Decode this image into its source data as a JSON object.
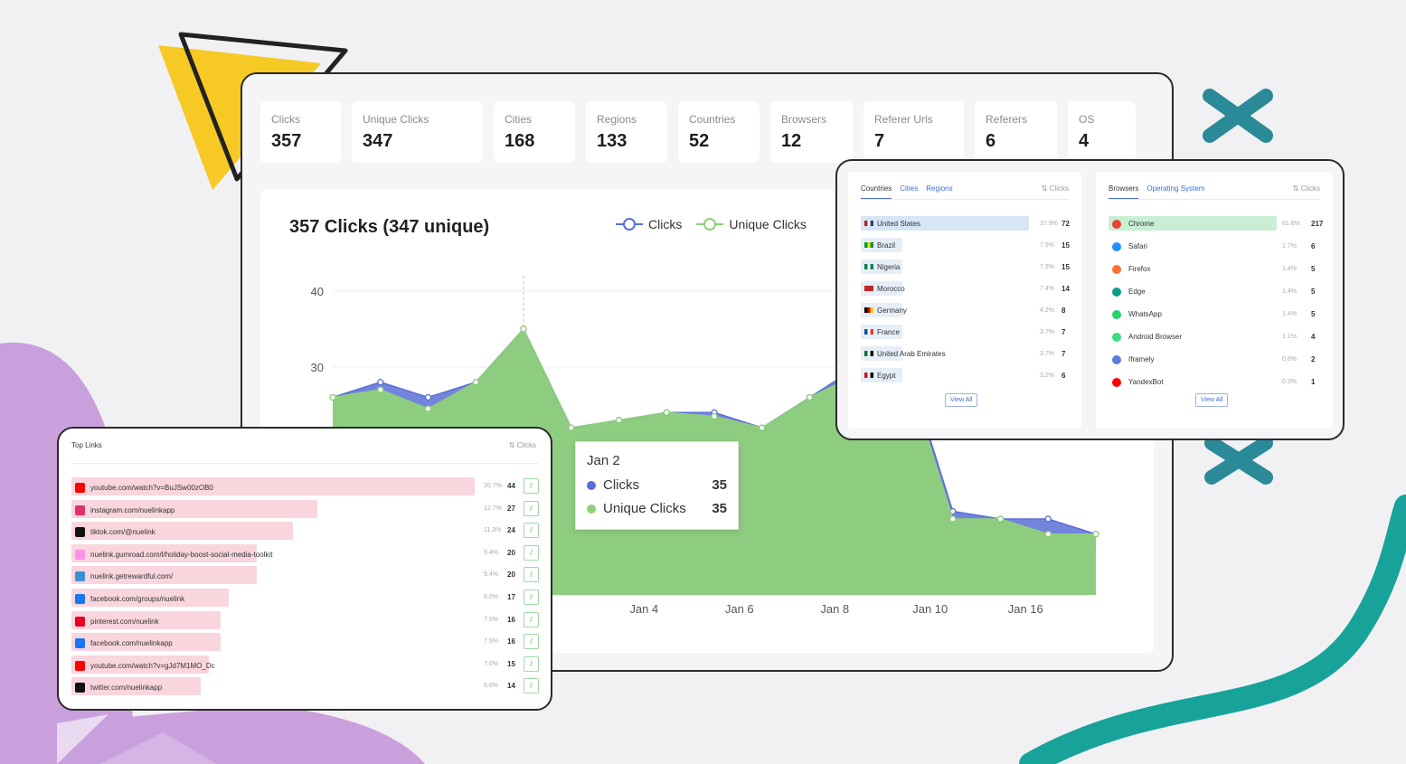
{
  "stats": [
    {
      "label": "Clicks",
      "value": "357"
    },
    {
      "label": "Unique Clicks",
      "value": "347"
    },
    {
      "label": "Cities",
      "value": "168"
    },
    {
      "label": "Regions",
      "value": "133"
    },
    {
      "label": "Countries",
      "value": "52"
    },
    {
      "label": "Browsers",
      "value": "12"
    },
    {
      "label": "Referer Urls",
      "value": "7"
    },
    {
      "label": "Referers",
      "value": "6"
    },
    {
      "label": "OS",
      "value": "4"
    }
  ],
  "chart": {
    "title": "357 Clicks (347 unique)",
    "legend": [
      "Clicks",
      "Unique Clicks"
    ],
    "colors": {
      "clicks": "#5a6fd6",
      "unique": "#8fd07a"
    },
    "tooltip": {
      "date": "Jan 2",
      "clicks_label": "Clicks",
      "clicks_value": "35",
      "unique_label": "Unique Clicks",
      "unique_value": "35"
    }
  },
  "chart_data": {
    "type": "area",
    "title": "357 Clicks (347 unique)",
    "y_ticks": [
      "40",
      "30"
    ],
    "x_tick_labels": [
      "Jan 4",
      "Jan 6",
      "Jan 8",
      "Jan 10",
      "Jan 16"
    ],
    "ylim": [
      0,
      42
    ],
    "series": [
      {
        "name": "Clicks",
        "values": [
          26,
          28,
          26,
          28,
          35,
          22,
          23,
          24,
          24,
          22,
          26,
          30,
          31,
          11,
          10,
          10,
          8
        ]
      },
      {
        "name": "Unique Clicks",
        "values": [
          26,
          27,
          24.5,
          28,
          35,
          22,
          23,
          24,
          23.5,
          22,
          26,
          29,
          30,
          10,
          10,
          8,
          8
        ]
      }
    ],
    "grid": true
  },
  "geo_card": {
    "tabs": [
      "Countries",
      "Cities",
      "Regions"
    ],
    "sort_label": "Clicks",
    "rows": [
      {
        "name": "United States",
        "pct": "37.9%",
        "count": "72",
        "frac": 1.0,
        "flag": [
          "#b22234",
          "#ffffff",
          "#3c3b6e"
        ]
      },
      {
        "name": "Brazil",
        "pct": "7.9%",
        "count": "15",
        "frac": 0.21,
        "flag": [
          "#009c3b",
          "#ffdf00",
          "#009c3b"
        ]
      },
      {
        "name": "Nigeria",
        "pct": "7.9%",
        "count": "15",
        "frac": 0.21,
        "flag": [
          "#008751",
          "#ffffff",
          "#008751"
        ]
      },
      {
        "name": "Morocco",
        "pct": "7.4%",
        "count": "14",
        "frac": 0.19,
        "flag": [
          "#c1272d",
          "#c1272d",
          "#c1272d"
        ]
      },
      {
        "name": "Germany",
        "pct": "4.2%",
        "count": "8",
        "frac": 0.11,
        "flag": [
          "#000000",
          "#dd0000",
          "#ffce00"
        ]
      },
      {
        "name": "France",
        "pct": "3.7%",
        "count": "7",
        "frac": 0.1,
        "flag": [
          "#0055a4",
          "#ffffff",
          "#ef4135"
        ]
      },
      {
        "name": "United Arab Emirates",
        "pct": "3.7%",
        "count": "7",
        "frac": 0.1,
        "flag": [
          "#00732f",
          "#ffffff",
          "#000000"
        ]
      },
      {
        "name": "Egypt",
        "pct": "3.2%",
        "count": "6",
        "frac": 0.08,
        "flag": [
          "#ce1126",
          "#ffffff",
          "#000000"
        ]
      }
    ],
    "view_all": "View All"
  },
  "browser_card": {
    "tabs": [
      "Browsers",
      "Operating System"
    ],
    "sort_label": "Clicks",
    "rows": [
      {
        "name": "Chrome",
        "pct": "61.8%",
        "count": "217",
        "frac": 1.0,
        "icon_color": "#ea4335"
      },
      {
        "name": "Safari",
        "pct": "1.7%",
        "count": "6",
        "frac": 0.03,
        "icon_color": "#1e90ff"
      },
      {
        "name": "Firefox",
        "pct": "1.4%",
        "count": "5",
        "frac": 0.02,
        "icon_color": "#ff7139"
      },
      {
        "name": "Edge",
        "pct": "1.4%",
        "count": "5",
        "frac": 0.02,
        "icon_color": "#0c9d8f"
      },
      {
        "name": "WhatsApp",
        "pct": "1.4%",
        "count": "5",
        "frac": 0.02,
        "icon_color": "#25d366"
      },
      {
        "name": "Android Browser",
        "pct": "1.1%",
        "count": "4",
        "frac": 0.02,
        "icon_color": "#3ddc84"
      },
      {
        "name": "Iframely",
        "pct": "0.6%",
        "count": "2",
        "frac": 0.01,
        "icon_color": "#5b7be0"
      },
      {
        "name": "YandexBot",
        "pct": "0.3%",
        "count": "1",
        "frac": 0.01,
        "icon_color": "#ff0000"
      }
    ],
    "view_all": "View All"
  },
  "top_links": {
    "title": "Top Links",
    "sort_label": "Clicks",
    "rows": [
      {
        "url": "youtube.com/watch?v=BuJSw00zOB0",
        "pct": "20.7%",
        "count": "44",
        "frac": 1.0,
        "icon_color": "#ff0000"
      },
      {
        "url": "instagram.com/nuelinkapp",
        "pct": "12.7%",
        "count": "27",
        "frac": 0.61,
        "icon_color": "#e1306c"
      },
      {
        "url": "tiktok.com/@nuelink",
        "pct": "11.3%",
        "count": "24",
        "frac": 0.55,
        "icon_color": "#111111"
      },
      {
        "url": "nuelink.gumroad.com/l/holiday-boost-social-media-toolkit",
        "pct": "9.4%",
        "count": "20",
        "frac": 0.46,
        "icon_color": "#ff90e8"
      },
      {
        "url": "nuelink.getrewardful.com/",
        "pct": "9.4%",
        "count": "20",
        "frac": 0.46,
        "icon_color": "#3a8fd6"
      },
      {
        "url": "facebook.com/groups/nuelink",
        "pct": "8.0%",
        "count": "17",
        "frac": 0.39,
        "icon_color": "#1877f2"
      },
      {
        "url": "pinterest.com/nuelink",
        "pct": "7.5%",
        "count": "16",
        "frac": 0.37,
        "icon_color": "#e60023"
      },
      {
        "url": "facebook.com/nuelinkapp",
        "pct": "7.5%",
        "count": "16",
        "frac": 0.37,
        "icon_color": "#1877f2"
      },
      {
        "url": "youtube.com/watch?v=gJd7M1MO_Dc",
        "pct": "7.0%",
        "count": "15",
        "frac": 0.34,
        "icon_color": "#ff0000"
      },
      {
        "url": "twitter.com/nuelinkapp",
        "pct": "6.6%",
        "count": "14",
        "frac": 0.32,
        "icon_color": "#111111"
      }
    ]
  }
}
